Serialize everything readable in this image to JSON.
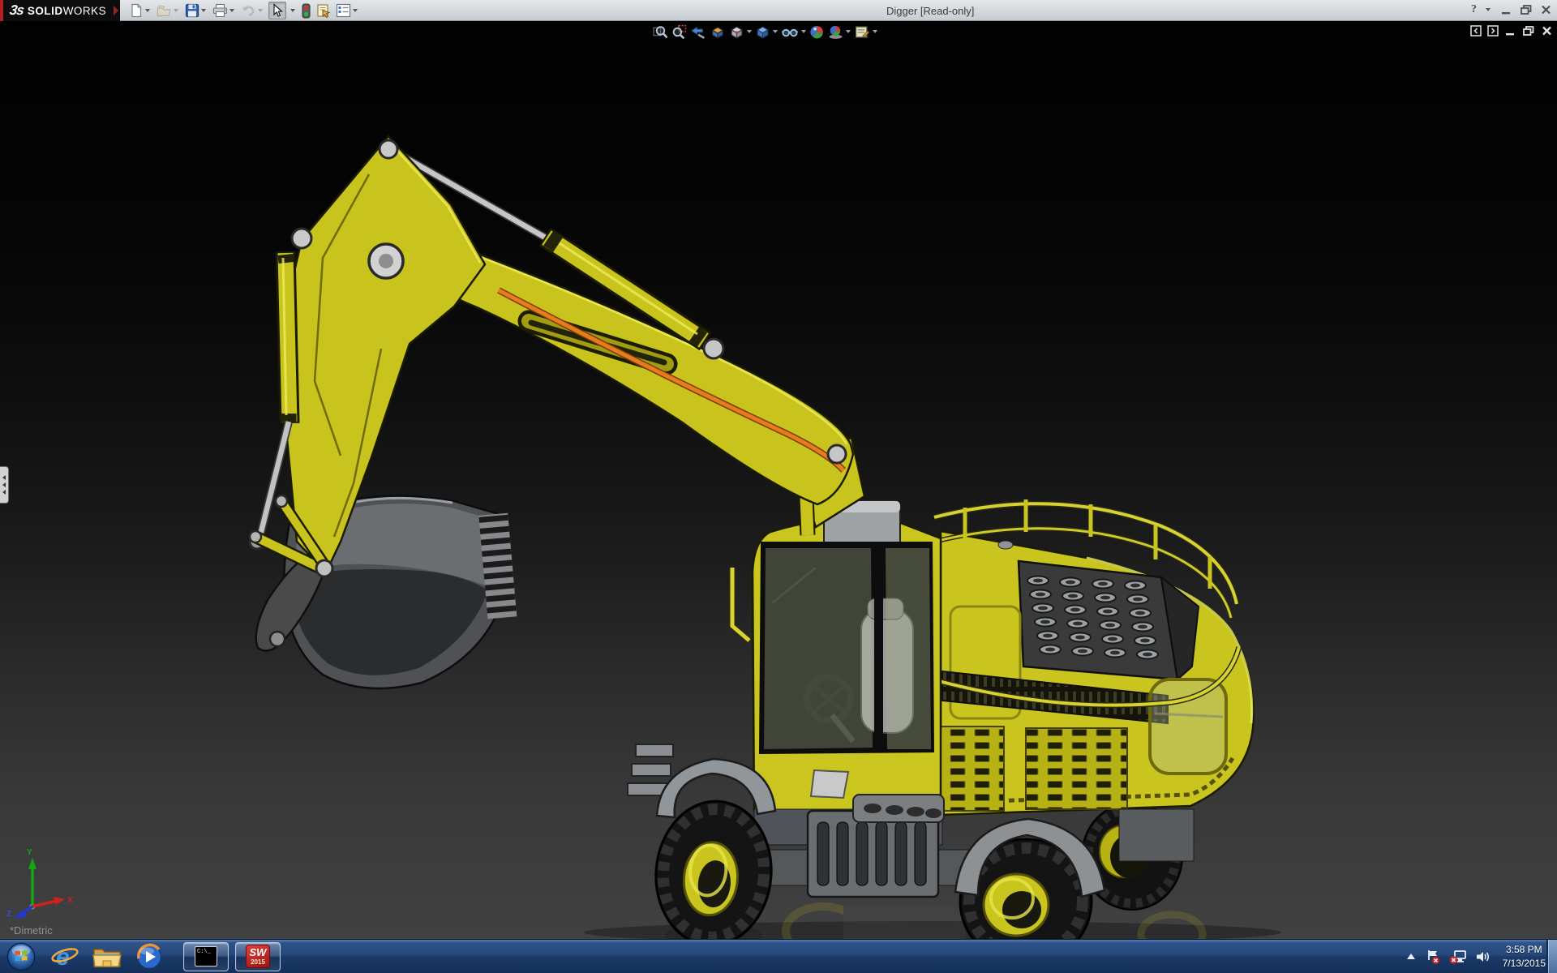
{
  "titlebar": {
    "brand_mark": "3s",
    "brand_bold": "SOLID",
    "brand_light": "WORKS",
    "title": "Digger [Read-only]",
    "help_label": "?",
    "toolbar_icons": [
      {
        "name": "new-document",
        "dropdown": true,
        "enabled": true
      },
      {
        "name": "open-document",
        "dropdown": true,
        "enabled": false
      },
      {
        "name": "save",
        "dropdown": true,
        "enabled": true
      },
      {
        "name": "print",
        "dropdown": true,
        "enabled": true
      },
      {
        "name": "undo",
        "dropdown": true,
        "enabled": false
      },
      {
        "name": "select",
        "dropdown": true,
        "enabled": true,
        "pressed": true
      },
      {
        "name": "rebuild-traffic-light",
        "dropdown": false,
        "enabled": true
      },
      {
        "name": "file-properties",
        "dropdown": false,
        "enabled": true
      },
      {
        "name": "options",
        "dropdown": true,
        "enabled": true
      }
    ],
    "window_controls": [
      "minimize",
      "restore",
      "close"
    ]
  },
  "headsup_toolbar": {
    "items": [
      "zoom-to-fit",
      "zoom-to-area",
      "previous-view",
      "section-view",
      "view-orientation",
      "display-style",
      "hide-show-items",
      "edit-appearance",
      "apply-scene",
      "view-settings"
    ]
  },
  "document_window": {
    "controls": [
      "panel-toggle-left",
      "panel-toggle-right",
      "minimize",
      "restore",
      "close"
    ]
  },
  "viewport": {
    "view_label": "*Dimetric",
    "triad": {
      "x_label": "X",
      "y_label": "Y",
      "z_label": "Z"
    },
    "model_name": "Digger"
  },
  "taskbar": {
    "apps": [
      "start",
      "internet-explorer",
      "windows-explorer",
      "media-player",
      "command-prompt",
      "solidworks-2015"
    ],
    "cmd_icon_text": "C:\\_",
    "sw_icon_text": "SW",
    "sw_icon_year": "2015",
    "tray": {
      "icons": [
        "show-hidden-icons",
        "action-center-flag",
        "network-disconnected",
        "volume"
      ],
      "time": "3:58 PM",
      "date": "7/13/2015"
    }
  },
  "colors": {
    "machine_yellow": "#c8c31d",
    "machine_yellow_bright": "#e9e54a",
    "hose_orange": "#e87b1e",
    "metal_gray": "#bfc2c4",
    "solidworks_red": "#b02025",
    "taskbar_blue": "#25487c",
    "viewport_top": "#020202",
    "viewport_bottom": "#414141",
    "titlebar_gray": "#d4d7db"
  }
}
